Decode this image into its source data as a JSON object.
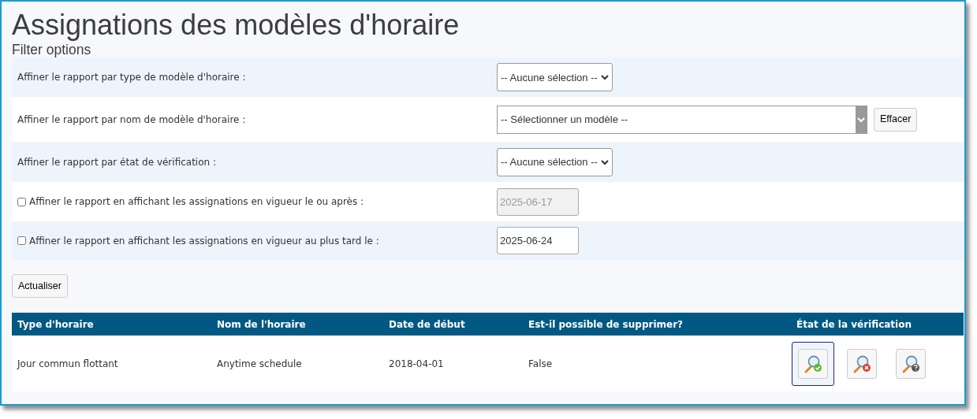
{
  "title": "Assignations des modèles d'horaire",
  "subtitle": "Filter options",
  "filters": [
    {
      "kind": "dropdown",
      "label": "Affiner le rapport par type de modèle d'horaire :",
      "value": "-- Aucune sélection --"
    },
    {
      "kind": "combobox",
      "label": "Affiner le rapport par nom de modèle d'horaire :",
      "value": "-- Sélectionner un modèle --",
      "button": "Effacer"
    },
    {
      "kind": "dropdown",
      "label": "Affiner le rapport par état de vérification :",
      "value": "-- Aucune sélection --"
    },
    {
      "kind": "date",
      "label": "Affiner le rapport en affichant les assignations en vigueur le ou après :",
      "checked": false,
      "value": "2025-06-17",
      "disabled": true
    },
    {
      "kind": "date",
      "label": "Affiner le rapport en affichant les assignations en vigueur au plus tard le :",
      "checked": false,
      "value": "2025-06-24",
      "disabled": false
    }
  ],
  "refresh_button": "Actualiser",
  "table": {
    "columns": [
      "Type d'horaire",
      "Nom de l'horaire",
      "Date de début",
      "Est-il possible de supprimer?",
      "État de la vérification"
    ],
    "rows": [
      {
        "cells": [
          "Jour commun flottant",
          "Anytime schedule",
          "2018-04-01",
          "False"
        ],
        "verification": [
          {
            "kind": "verified",
            "selected": true
          },
          {
            "kind": "rejected",
            "selected": false
          },
          {
            "kind": "unknown",
            "selected": false
          }
        ]
      }
    ]
  }
}
